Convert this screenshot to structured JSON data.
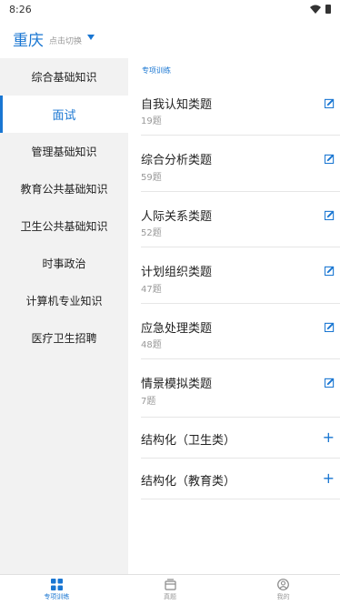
{
  "status_bar": {
    "time": "8:26"
  },
  "header": {
    "city": "重庆",
    "switch_hint": "点击切换"
  },
  "sidebar": {
    "items": [
      {
        "label": "综合基础知识",
        "active": false
      },
      {
        "label": "面试",
        "active": true
      },
      {
        "label": "管理基础知识",
        "active": false
      },
      {
        "label": "教育公共基础知识",
        "active": false
      },
      {
        "label": "卫生公共基础知识",
        "active": false
      },
      {
        "label": "时事政治",
        "active": false
      },
      {
        "label": "计算机专业知识",
        "active": false
      },
      {
        "label": "医疗卫生招聘",
        "active": false
      }
    ]
  },
  "content": {
    "section_label": "专项训练",
    "items": [
      {
        "title": "自我认知类题",
        "count": "19题"
      },
      {
        "title": "综合分析类题",
        "count": "59题"
      },
      {
        "title": "人际关系类题",
        "count": "52题"
      },
      {
        "title": "计划组织类题",
        "count": "47题"
      },
      {
        "title": "应急处理类题",
        "count": "48题"
      },
      {
        "title": "情景模拟类题",
        "count": "7题"
      }
    ],
    "groups": [
      {
        "title": "结构化（卫生类）"
      },
      {
        "title": "结构化（教育类）"
      }
    ]
  },
  "bottom_nav": {
    "items": [
      {
        "label": "专项训练",
        "active": true
      },
      {
        "label": "真题",
        "active": false
      },
      {
        "label": "我的",
        "active": false
      }
    ]
  },
  "colors": {
    "accent": "#1976d2",
    "sidebar_bg": "#f2f2f2",
    "muted_text": "#999999"
  }
}
